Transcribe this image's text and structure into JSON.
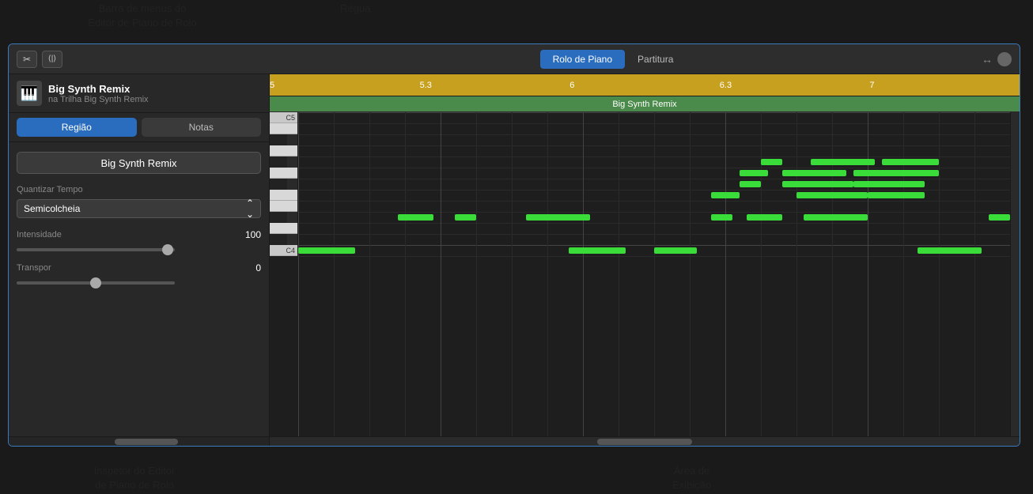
{
  "annotations": {
    "menu_bar_label": "Barra de menus do\nEditor de Piano de Rolo",
    "ruler_label": "Régua",
    "inspector_label": "Inspetor do Editor\nde Piano de Rolo",
    "display_label": "Área de\nExibição"
  },
  "top_bar": {
    "tab_piano_roll": "Rolo de Piano",
    "tab_score": "Partitura"
  },
  "track": {
    "name": "Big Synth Remix",
    "sub_label": "na Trilha Big Synth Remix",
    "icon": "🎹"
  },
  "inspector_tabs": {
    "region": "Região",
    "notes": "Notas"
  },
  "region_name": "Big Synth Remix",
  "params": {
    "quantize_label": "Quantizar Tempo",
    "quantize_value": "Semicolcheia",
    "intensity_label": "Intensidade",
    "intensity_value": "100",
    "transpose_label": "Transpor",
    "transpose_value": "0"
  },
  "ruler": {
    "markers": [
      {
        "label": "5",
        "x_pct": 0
      },
      {
        "label": "5.3",
        "x_pct": 20
      },
      {
        "label": "6",
        "x_pct": 40
      },
      {
        "label": "6.3",
        "x_pct": 60
      },
      {
        "label": "7",
        "x_pct": 80
      }
    ]
  },
  "region_bar_label": "Big Synth Remix",
  "piano_keys": [
    {
      "note": "C5",
      "type": "white",
      "labeled": true
    },
    {
      "note": "B4",
      "type": "white"
    },
    {
      "note": "Bb4",
      "type": "black"
    },
    {
      "note": "A4",
      "type": "white"
    },
    {
      "note": "Ab4",
      "type": "black"
    },
    {
      "note": "G4",
      "type": "white"
    },
    {
      "note": "Gb4",
      "type": "black"
    },
    {
      "note": "F4",
      "type": "white"
    },
    {
      "note": "E4",
      "type": "white"
    },
    {
      "note": "Eb4",
      "type": "black"
    },
    {
      "note": "D4",
      "type": "white"
    },
    {
      "note": "Db4",
      "type": "black"
    },
    {
      "note": "C4",
      "type": "white",
      "labeled": true
    }
  ],
  "notes": [
    {
      "row": 12,
      "x_pct": 0,
      "w_pct": 8
    },
    {
      "row": 12,
      "x_pct": 38,
      "w_pct": 8
    },
    {
      "row": 12,
      "x_pct": 50,
      "w_pct": 6
    },
    {
      "row": 12,
      "x_pct": 87,
      "w_pct": 9
    },
    {
      "row": 9,
      "x_pct": 14,
      "w_pct": 5
    },
    {
      "row": 9,
      "x_pct": 22,
      "w_pct": 3
    },
    {
      "row": 9,
      "x_pct": 32,
      "w_pct": 9
    },
    {
      "row": 9,
      "x_pct": 58,
      "w_pct": 3
    },
    {
      "row": 9,
      "x_pct": 63,
      "w_pct": 5
    },
    {
      "row": 9,
      "x_pct": 71,
      "w_pct": 9
    },
    {
      "row": 9,
      "x_pct": 97,
      "w_pct": 3
    },
    {
      "row": 7,
      "x_pct": 58,
      "w_pct": 4
    },
    {
      "row": 7,
      "x_pct": 70,
      "w_pct": 10
    },
    {
      "row": 7,
      "x_pct": 80,
      "w_pct": 8
    },
    {
      "row": 6,
      "x_pct": 62,
      "w_pct": 3
    },
    {
      "row": 6,
      "x_pct": 68,
      "w_pct": 10
    },
    {
      "row": 6,
      "x_pct": 78,
      "w_pct": 10
    },
    {
      "row": 5,
      "x_pct": 62,
      "w_pct": 4
    },
    {
      "row": 5,
      "x_pct": 68,
      "w_pct": 9
    },
    {
      "row": 5,
      "x_pct": 78,
      "w_pct": 12
    },
    {
      "row": 4,
      "x_pct": 65,
      "w_pct": 3
    },
    {
      "row": 4,
      "x_pct": 72,
      "w_pct": 9
    },
    {
      "row": 4,
      "x_pct": 82,
      "w_pct": 8
    }
  ],
  "colors": {
    "accent_blue": "#2a6dbf",
    "green_note": "#3adc3a",
    "ruler_gold": "#c8a020",
    "region_green": "#4a8a4a"
  }
}
